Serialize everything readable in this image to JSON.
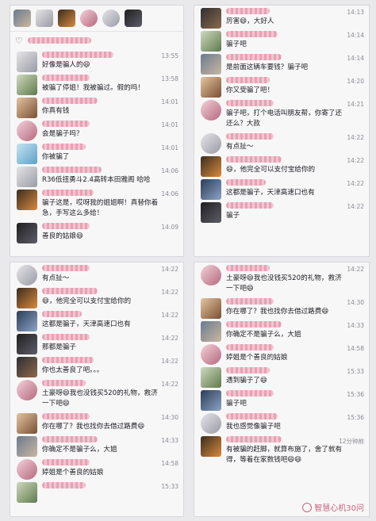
{
  "panel1": {
    "likes_name": "",
    "messages": [
      {
        "text": "好像是骗人的😄",
        "time": "13:55"
      },
      {
        "text": "被骗了停姐！我被骗过。假的吗！",
        "time": "13:58"
      },
      {
        "text": "你真有钱",
        "time": "14:01"
      },
      {
        "text": "会是骗子吗？",
        "time": "14:01"
      },
      {
        "text": "你被骗了",
        "time": "14:01"
      },
      {
        "text": "R36低扭勇斗2.4高转本田雅阁 哈哈",
        "time": "14:06"
      },
      {
        "text": "骗子这是，哎呀我的姐姐啊！真替你着急，手写这么多给！",
        "time": "14:06"
      },
      {
        "text": "善良的姑娘😄",
        "time": "14:09"
      }
    ]
  },
  "panel2": {
    "messages": [
      {
        "text": "厉害😄，大好人",
        "time": "14:13"
      },
      {
        "text": "骗子吧",
        "time": "14:14"
      },
      {
        "text": "是前面这辆车要钱？骗子吧",
        "time": "14:14"
      },
      {
        "text": "你又受骗了吧！",
        "time": "14:20"
      },
      {
        "text": "骗子吧，打个电话叫朋友帮，你寄了还还么？大款",
        "time": "14:21"
      },
      {
        "text": "有点扯～",
        "time": "14:22"
      },
      {
        "text": "😄，他完全可以支付宝给你的",
        "time": "14:22"
      },
      {
        "text": "这都是骗子，天津高速口也有",
        "time": "14:22"
      },
      {
        "text": "骗子",
        "time": "14:22"
      }
    ]
  },
  "panel3": {
    "messages": [
      {
        "text": "有点扯～",
        "time": "14:22"
      },
      {
        "text": "😄，他完全可以支付宝给你的",
        "time": "14:22"
      },
      {
        "text": "这都是骗子，天津高速口也有",
        "time": "14:22"
      },
      {
        "text": "那都是骗子",
        "time": "14:22"
      },
      {
        "text": "你也太善良了吧。。。",
        "time": "14:22"
      },
      {
        "text": "土豪呀😄我也没钱买520的礼物，救济一下吧😄",
        "time": "14:22"
      },
      {
        "text": "你在哪了？我也找你去借过路费😄",
        "time": "14:30"
      },
      {
        "text": "你确定不是骗子么，大姐",
        "time": "14:33"
      },
      {
        "text": "婷姐是个善良的姑娘",
        "time": "14:58"
      },
      {
        "text": "",
        "time": "15:33"
      }
    ]
  },
  "panel4": {
    "messages": [
      {
        "text": "土豪呀😄我也没钱买520的礼物，救济一下吧😄",
        "time": "14:22"
      },
      {
        "text": "你在哪了？我也找你去借过路费😄",
        "time": "14:30"
      },
      {
        "text": "你确定不是骗子么，大姐",
        "time": "14:33"
      },
      {
        "text": "婷姐是个善良的姑娘",
        "time": "14:58"
      },
      {
        "text": "遇到骗子了😄",
        "time": "15:33"
      },
      {
        "text": "骗子吧",
        "time": "15:36"
      },
      {
        "text": "我也感觉像骗子吧",
        "time": "15:36"
      },
      {
        "text": "有被骗的赶脚，就算布施了，舍了就有得，等着在家数钱吧😄😄",
        "time": "12分钟前"
      }
    ],
    "watermark": "智慧心机30问"
  }
}
